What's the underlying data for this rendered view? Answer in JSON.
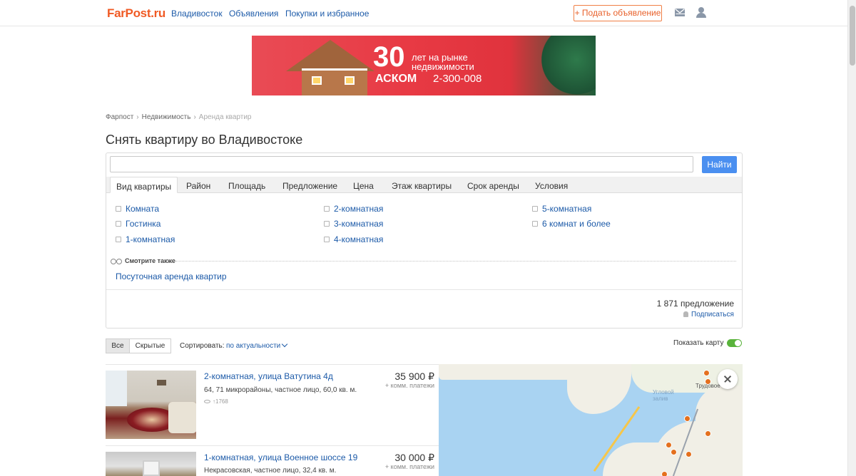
{
  "header": {
    "logo": "FarPost.ru",
    "nav": [
      "Владивосток",
      "Объявления",
      "Покупки и избранное"
    ],
    "add_button": "+ Подать объявление"
  },
  "banner": {
    "number": "30",
    "tagline_1": "лет на рынке",
    "tagline_2": "недвижимости",
    "brand": "АСКОМ",
    "phone": "2-300-008"
  },
  "breadcrumb": [
    "Фарпост",
    "Недвижимость",
    "Аренда квартир"
  ],
  "page_title": "Снять квартиру во Владивостоке",
  "search": {
    "value": "",
    "button": "Найти"
  },
  "tabs": [
    "Вид квартиры",
    "Район",
    "Площадь",
    "Предложение",
    "Цена",
    "Этаж квартиры",
    "Срок аренды",
    "Условия"
  ],
  "room_types": {
    "col1": [
      "Комната",
      "Гостинка",
      "1-комнатная"
    ],
    "col2": [
      "2-комнатная",
      "3-комнатная",
      "4-комнатная"
    ],
    "col3": [
      "5-комнатная",
      "6 комнат и более"
    ]
  },
  "see_also": {
    "label": "Смотрите также",
    "link": "Посуточная аренда квартир"
  },
  "results": {
    "count": "1 871 предложение",
    "subscribe": "Подписаться"
  },
  "filters": {
    "all": "Все",
    "hidden": "Скрытые",
    "sort_label": "Сортировать:",
    "sort_value": "по актуальности",
    "show_map": "Показать карту"
  },
  "listings": [
    {
      "title": "2-комнатная, улица Ватутина 4д",
      "subtitle": "64, 71 микрорайоны, частное лицо, 60,0 кв. м.",
      "views": "1768",
      "price": "35 900 ₽",
      "price_note": "+ комм. платежи"
    },
    {
      "title": "1-комнатная, улица Военное шоссе 19",
      "subtitle": "Некрасовская, частное лицо, 32,4 кв. м.",
      "views": "",
      "price": "30 000 ₽",
      "price_note": "+ комм. платежи"
    }
  ],
  "map": {
    "labels": [
      "Угловой залив",
      "Трудовое"
    ]
  },
  "colors": {
    "brand": "#f05a24",
    "link": "#1c5aa8",
    "search_button": "#4a8ff0",
    "toggle_on": "#59b33b",
    "map_pin": "#e4701e"
  }
}
